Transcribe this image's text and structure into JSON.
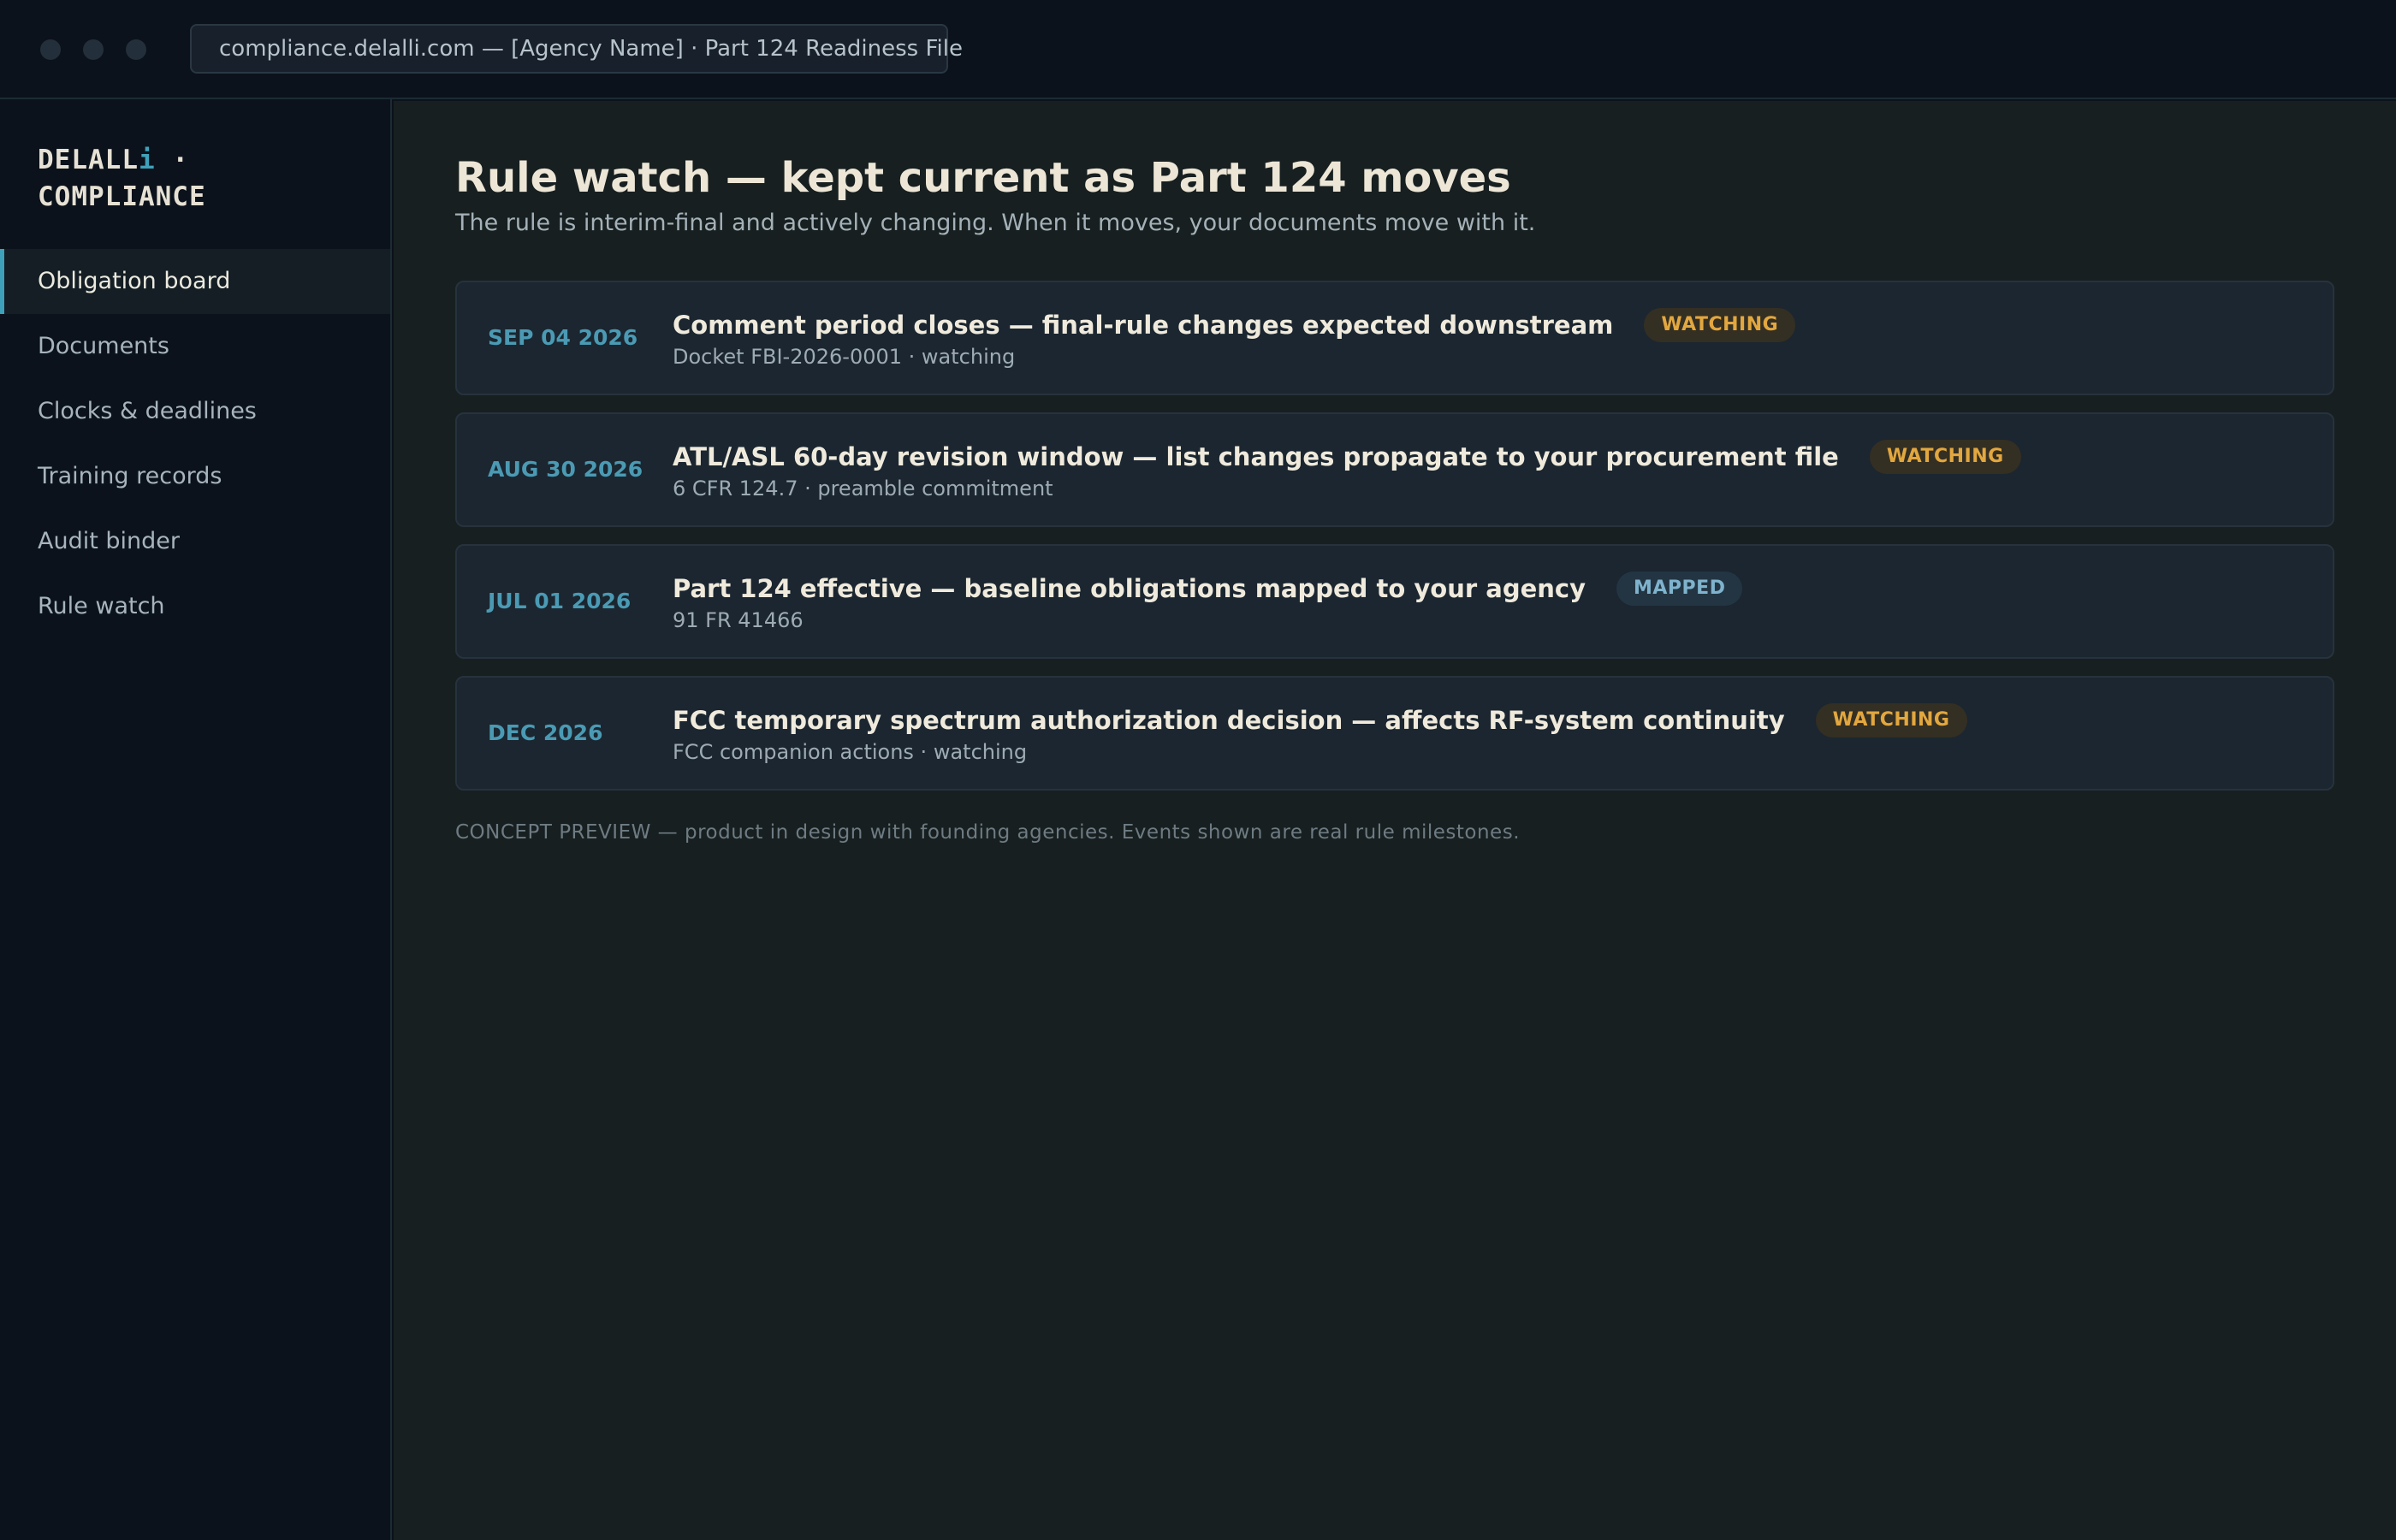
{
  "window": {
    "address": "compliance.delalli.com — [Agency Name] · Part 124 Readiness File"
  },
  "brand": {
    "name_part1": "DELALL",
    "name_accent": "i",
    "name_part2": " ·",
    "line2": "COMPLIANCE",
    "accent_color": "#3fa1b9"
  },
  "sidebar": {
    "items": [
      {
        "label": "Obligation board",
        "active": true
      },
      {
        "label": "Documents",
        "active": false
      },
      {
        "label": "Clocks & deadlines",
        "active": false
      },
      {
        "label": "Training records",
        "active": false
      },
      {
        "label": "Audit binder",
        "active": false
      },
      {
        "label": "Rule watch",
        "active": false
      }
    ]
  },
  "main": {
    "title": "Rule watch — kept current as Part 124 moves",
    "subtitle": "The rule is interim-final and actively changing. When it moves, your documents move with it.",
    "events": [
      {
        "date": "SEP 04 2026",
        "title": "Comment period closes — final-rule changes expected downstream",
        "meta": "Docket FBI-2026-0001 · watching",
        "status": "WATCHING",
        "status_color": "#e2a73f"
      },
      {
        "date": "AUG 30 2026",
        "title": "ATL/ASL 60-day revision window — list changes propagate to your procurement file",
        "meta": "6 CFR 124.7 · preamble commitment",
        "status": "WATCHING",
        "status_color": "#e2a73f"
      },
      {
        "date": "JUL 01 2026",
        "title": "Part 124 effective — baseline obligations mapped to your agency",
        "meta": "91 FR 41466",
        "status": "MAPPED",
        "status_color": "#7fb3cd"
      },
      {
        "date": "DEC 2026",
        "title": "FCC temporary spectrum authorization decision — affects RF-system continuity",
        "meta": "FCC companion actions · watching",
        "status": "WATCHING",
        "status_color": "#e2a73f"
      }
    ],
    "footnote": "CONCEPT PREVIEW — product in design with founding agencies. Events shown are real rule milestones."
  }
}
